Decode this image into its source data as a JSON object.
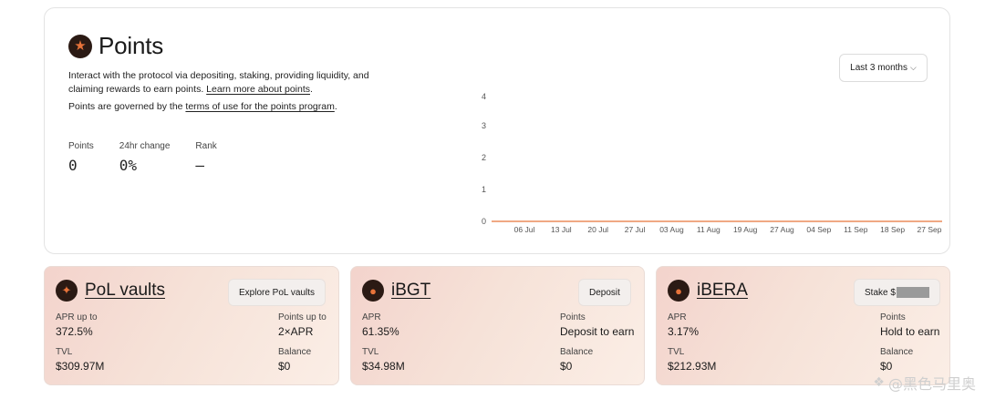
{
  "points": {
    "title": "Points",
    "desc_line": "Interact with the protocol via depositing, staking, providing liquidity, and claiming rewards to earn points.",
    "learn_more": "Learn more about points",
    "governed_prefix": "Points are governed by the",
    "terms_link": "terms of use for the points program",
    "governed_suffix": ".",
    "range_label": "Last 3 months",
    "stats": [
      {
        "label": "Points",
        "value": "0"
      },
      {
        "label": "24hr change",
        "value": "0%"
      },
      {
        "label": "Rank",
        "value": "—"
      }
    ]
  },
  "chart_data": {
    "type": "line",
    "x": [
      "06 Jul",
      "13 Jul",
      "20 Jul",
      "27 Jul",
      "03 Aug",
      "11 Aug",
      "19 Aug",
      "27 Aug",
      "04 Sep",
      "11 Sep",
      "18 Sep",
      "27 Sep"
    ],
    "series": [
      {
        "values": [
          0,
          0,
          0,
          0,
          0,
          0,
          0,
          0,
          0,
          0,
          0,
          0
        ]
      }
    ],
    "yticks": [
      "4",
      "3",
      "2",
      "1",
      "0"
    ],
    "ylim": [
      0,
      4
    ],
    "grid": false,
    "line_color": "#e8733a"
  },
  "tiles": [
    {
      "name": "PoL vaults",
      "button": "Explore PoL vaults",
      "left_label_1": "APR up to",
      "left_value_1": "372.5%",
      "right_label_1": "Points up to",
      "right_value_1": "2×APR",
      "left_label_2": "TVL",
      "left_value_2": "$309.97M",
      "right_label_2": "Balance",
      "right_value_2": "$0"
    },
    {
      "name": "iBGT",
      "button": "Deposit",
      "left_label_1": "APR",
      "left_value_1": "61.35%",
      "right_label_1": "Points",
      "right_value_1": "Deposit to earn",
      "left_label_2": "TVL",
      "left_value_2": "$34.98M",
      "right_label_2": "Balance",
      "right_value_2": "$0"
    },
    {
      "name": "iBERA",
      "button": "Stake $",
      "left_label_1": "APR",
      "left_value_1": "3.17%",
      "right_label_1": "Points",
      "right_value_1": "Hold to earn",
      "left_label_2": "TVL",
      "left_value_2": "$212.93M",
      "right_label_2": "Balance",
      "right_value_2": "$0"
    }
  ],
  "watermark": "@黑色马里奥",
  "icons": {
    "points_logo": "star-badge-icon",
    "range_chevron": "chevron-down-icon"
  },
  "colors": {
    "accent": "#e8733a",
    "tile_gradient_start": "#f3d3cc",
    "tile_gradient_end": "#fbeee6"
  }
}
